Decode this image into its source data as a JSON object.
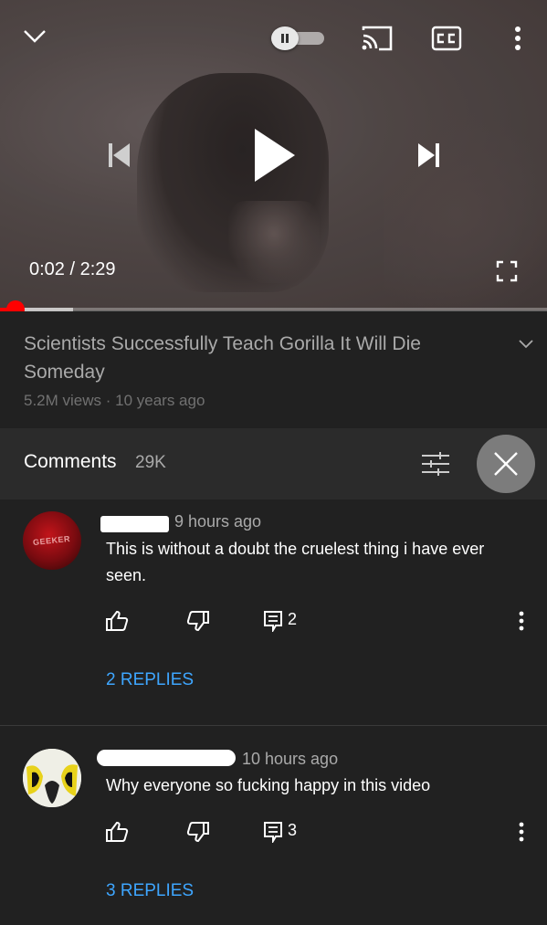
{
  "player": {
    "current_time": "0:02",
    "separator": "/",
    "duration": "2:29",
    "progress_played_fraction": 0.028,
    "progress_buffered_fraction": 0.134,
    "autoplay_state": "paused",
    "icons": [
      "chevron-down-icon",
      "autoplay-toggle",
      "cast-icon",
      "captions-icon",
      "more-vertical-icon",
      "previous-icon",
      "play-icon",
      "next-icon",
      "fullscreen-icon"
    ]
  },
  "video": {
    "title": "Scientists Successfully Teach Gorilla It Will Die Someday",
    "meta": "5.2M views · 10 years ago"
  },
  "comments": {
    "label": "Comments",
    "count": "29K",
    "items": [
      {
        "avatar_text": "GEEKER",
        "time": "9 hours ago",
        "text": "This is without a doubt the cruelest thing i have ever seen.",
        "reply_count": "2",
        "replies_link": "2 REPLIES"
      },
      {
        "avatar_text": "",
        "time": "10 hours ago",
        "text": "Why everyone so fucking happy in this video",
        "reply_count": "3",
        "replies_link": "3 REPLIES"
      }
    ]
  },
  "colors": {
    "background": "#212121",
    "header_bg": "#2b2b2b",
    "progress_red": "#ff0000",
    "link_blue": "#3ea6ff",
    "secondary_text": "#aaaaaa"
  }
}
